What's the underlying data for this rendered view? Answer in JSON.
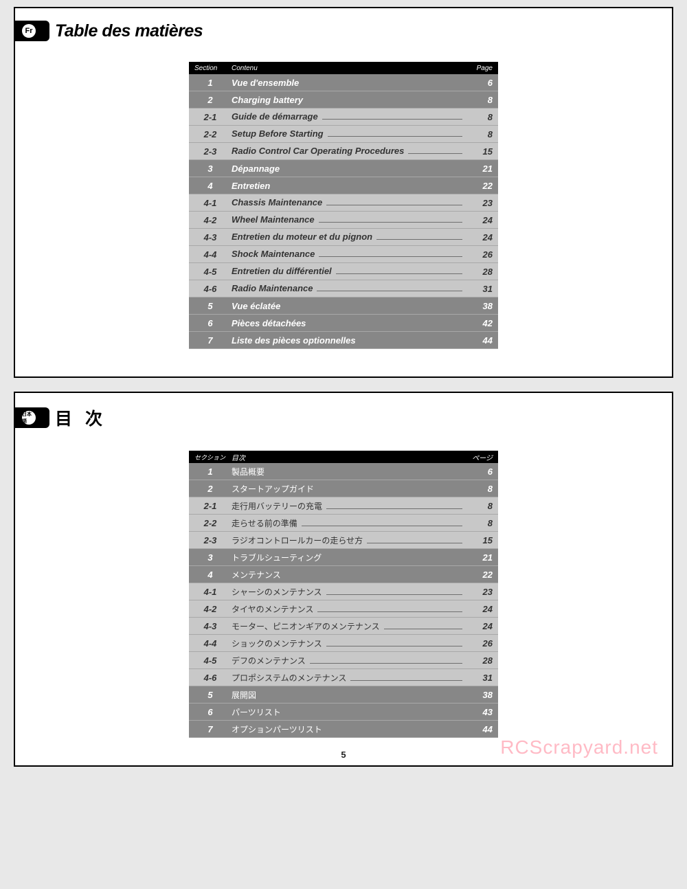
{
  "page_number": "5",
  "watermark": "RCScrapyard.net",
  "panels": [
    {
      "lang_badge": "Fr",
      "title": "Table des matières",
      "title_class": "fr",
      "headers": {
        "section": "Section",
        "content": "Contenu",
        "page": "Page"
      },
      "rows": [
        {
          "sec": "1",
          "title": "Vue d'ensemble",
          "page": "6",
          "type": "main"
        },
        {
          "sec": "2",
          "title": "Charging battery",
          "page": "8",
          "type": "main"
        },
        {
          "sec": "2-1",
          "title": "Guide de démarrage",
          "page": "8",
          "type": "sub"
        },
        {
          "sec": "2-2",
          "title": "Setup Before Starting",
          "page": "8",
          "type": "sub"
        },
        {
          "sec": "2-3",
          "title": "Radio Control Car Operating Procedures",
          "page": "15",
          "type": "sub"
        },
        {
          "sec": "3",
          "title": "Dépannage",
          "page": "21",
          "type": "main"
        },
        {
          "sec": "4",
          "title": "Entretien",
          "page": "22",
          "type": "main"
        },
        {
          "sec": "4-1",
          "title": "Chassis Maintenance",
          "page": "23",
          "type": "sub"
        },
        {
          "sec": "4-2",
          "title": "Wheel Maintenance",
          "page": "24",
          "type": "sub"
        },
        {
          "sec": "4-3",
          "title": "Entretien du moteur et du pignon",
          "page": "24",
          "type": "sub"
        },
        {
          "sec": "4-4",
          "title": "Shock Maintenance",
          "page": "26",
          "type": "sub"
        },
        {
          "sec": "4-5",
          "title": "Entretien du différentiel",
          "page": "28",
          "type": "sub"
        },
        {
          "sec": "4-6",
          "title": "Radio Maintenance",
          "page": "31",
          "type": "sub"
        },
        {
          "sec": "5",
          "title": "Vue éclatée",
          "page": "38",
          "type": "main"
        },
        {
          "sec": "6",
          "title": "Pièces détachées",
          "page": "42",
          "type": "main"
        },
        {
          "sec": "7",
          "title": "Liste des pièces optionnelles",
          "page": "44",
          "type": "main"
        }
      ]
    },
    {
      "lang_badge": "日本語",
      "title": "目 次",
      "title_class": "jp",
      "headers": {
        "section": "セクション",
        "content": "目次",
        "page": "ページ"
      },
      "rows": [
        {
          "sec": "1",
          "title": "製品概要",
          "page": "6",
          "type": "main"
        },
        {
          "sec": "2",
          "title": "スタートアップガイド",
          "page": "8",
          "type": "main"
        },
        {
          "sec": "2-1",
          "title": "走行用バッテリーの充電",
          "page": "8",
          "type": "sub"
        },
        {
          "sec": "2-2",
          "title": "走らせる前の準備",
          "page": "8",
          "type": "sub"
        },
        {
          "sec": "2-3",
          "title": "ラジオコントロールカーの走らせ方",
          "page": "15",
          "type": "sub"
        },
        {
          "sec": "3",
          "title": "トラブルシューティング",
          "page": "21",
          "type": "main"
        },
        {
          "sec": "4",
          "title": "メンテナンス",
          "page": "22",
          "type": "main"
        },
        {
          "sec": "4-1",
          "title": "シャーシのメンテナンス",
          "page": "23",
          "type": "sub"
        },
        {
          "sec": "4-2",
          "title": "タイヤのメンテナンス",
          "page": "24",
          "type": "sub"
        },
        {
          "sec": "4-3",
          "title": "モーター、ピニオンギアのメンテナンス",
          "page": "24",
          "type": "sub"
        },
        {
          "sec": "4-4",
          "title": "ショックのメンテナンス",
          "page": "26",
          "type": "sub"
        },
        {
          "sec": "4-5",
          "title": "デフのメンテナンス",
          "page": "28",
          "type": "sub"
        },
        {
          "sec": "4-6",
          "title": "プロポシステムのメンテナンス",
          "page": "31",
          "type": "sub"
        },
        {
          "sec": "5",
          "title": "展開図",
          "page": "38",
          "type": "main"
        },
        {
          "sec": "6",
          "title": "パーツリスト",
          "page": "43",
          "type": "main"
        },
        {
          "sec": "7",
          "title": "オプションパーツリスト",
          "page": "44",
          "type": "main"
        }
      ]
    }
  ]
}
